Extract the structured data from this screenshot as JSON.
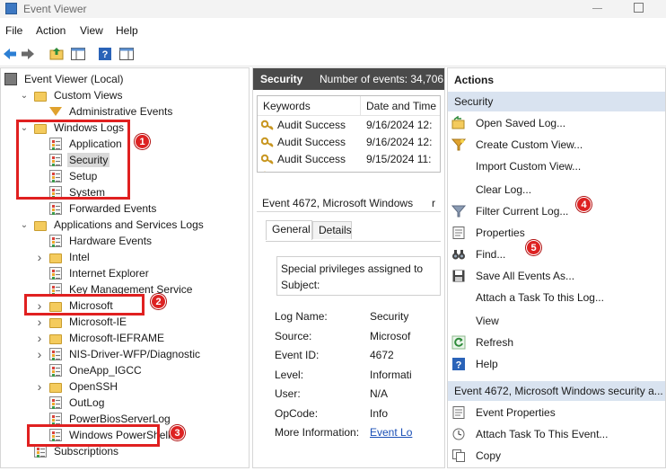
{
  "window": {
    "title": "Event Viewer"
  },
  "menu": [
    "File",
    "Action",
    "View",
    "Help"
  ],
  "tree": {
    "items": [
      {
        "label": "Event Viewer (Local)",
        "icon": "event-viewer-icon",
        "expander": ""
      },
      {
        "label": "Custom Views",
        "icon": "folder-icon",
        "expander": "expanded"
      },
      {
        "label": "Administrative Events",
        "icon": "filter-icon",
        "expander": ""
      },
      {
        "label": "Windows Logs",
        "icon": "folder-icon",
        "expander": "expanded"
      },
      {
        "label": "Application",
        "icon": "log-icon",
        "expander": ""
      },
      {
        "label": "Security",
        "icon": "log-icon",
        "expander": "",
        "selected": true
      },
      {
        "label": "Setup",
        "icon": "log-icon",
        "expander": ""
      },
      {
        "label": "System",
        "icon": "log-icon",
        "expander": ""
      },
      {
        "label": "Forwarded Events",
        "icon": "log-icon",
        "expander": ""
      },
      {
        "label": "Applications and Services Logs",
        "icon": "folder-icon",
        "expander": "expanded"
      },
      {
        "label": "Hardware Events",
        "icon": "log-icon",
        "expander": ""
      },
      {
        "label": "Intel",
        "icon": "folder-icon",
        "expander": "collapsed"
      },
      {
        "label": "Internet Explorer",
        "icon": "log-icon",
        "expander": ""
      },
      {
        "label": "Key Management Service",
        "icon": "log-icon",
        "expander": ""
      },
      {
        "label": "Microsoft",
        "icon": "folder-icon",
        "expander": "collapsed"
      },
      {
        "label": "Microsoft-IE",
        "icon": "folder-icon",
        "expander": "collapsed"
      },
      {
        "label": "Microsoft-IEFRAME",
        "icon": "folder-icon",
        "expander": "collapsed"
      },
      {
        "label": "NIS-Driver-WFP/Diagnostic",
        "icon": "log-icon",
        "expander": "collapsed"
      },
      {
        "label": "OneApp_IGCC",
        "icon": "log-icon",
        "expander": ""
      },
      {
        "label": "OpenSSH",
        "icon": "folder-icon",
        "expander": "collapsed"
      },
      {
        "label": "OutLog",
        "icon": "log-icon",
        "expander": ""
      },
      {
        "label": "PowerBiosServerLog",
        "icon": "log-icon",
        "expander": ""
      },
      {
        "label": "Windows PowerShell",
        "icon": "log-icon",
        "expander": ""
      },
      {
        "label": "Subscriptions",
        "icon": "log-icon",
        "expander": ""
      }
    ]
  },
  "badges": [
    "1",
    "2",
    "3",
    "4",
    "5"
  ],
  "middle": {
    "log_name": "Security",
    "event_count": "Number of events: 34,706",
    "columns": [
      "Keywords",
      "Date and Time"
    ],
    "rows": [
      {
        "keyword": "Audit Success",
        "date": "9/16/2024 12:"
      },
      {
        "keyword": "Audit Success",
        "date": "9/16/2024 12:"
      },
      {
        "keyword": "Audit Success",
        "date": "9/15/2024 11:"
      }
    ],
    "detail_title": "Event 4672, Microsoft Windows",
    "detail_close": "r",
    "tabs": [
      "General",
      "Details"
    ],
    "description_line1": "Special privileges assigned to",
    "description_line2": "Subject:",
    "fields": [
      {
        "key": "Log Name:",
        "value": "Security"
      },
      {
        "key": "Source:",
        "value": "Microsof"
      },
      {
        "key": "Event ID:",
        "value": "4672"
      },
      {
        "key": "Level:",
        "value": "Informati"
      },
      {
        "key": "User:",
        "value": "N/A"
      },
      {
        "key": "OpCode:",
        "value": "Info"
      },
      {
        "key": "More Information:",
        "value": "Event Lo"
      }
    ]
  },
  "actions": {
    "title": "Actions",
    "section1": "Security",
    "items1": [
      {
        "label": "Open Saved Log...",
        "icon": "open-log-icon"
      },
      {
        "label": "Create Custom View...",
        "icon": "create-view-icon"
      },
      {
        "label": "Import Custom View...",
        "icon": ""
      },
      {
        "label": "Clear Log...",
        "icon": ""
      },
      {
        "label": "Filter Current Log...",
        "icon": "filter-icon"
      },
      {
        "label": "Properties",
        "icon": "properties-icon"
      },
      {
        "label": "Find...",
        "icon": "binoculars-icon"
      },
      {
        "label": "Save All Events As...",
        "icon": "save-icon"
      },
      {
        "label": "Attach a Task To this Log...",
        "icon": ""
      },
      {
        "label": "View",
        "icon": ""
      },
      {
        "label": "Refresh",
        "icon": "refresh-icon"
      },
      {
        "label": "Help",
        "icon": "help-icon"
      }
    ],
    "section2": "Event 4672, Microsoft Windows security a...",
    "items2": [
      {
        "label": "Event Properties",
        "icon": "properties-icon"
      },
      {
        "label": "Attach Task To This Event...",
        "icon": "task-icon"
      },
      {
        "label": "Copy",
        "icon": "copy-icon"
      }
    ]
  }
}
